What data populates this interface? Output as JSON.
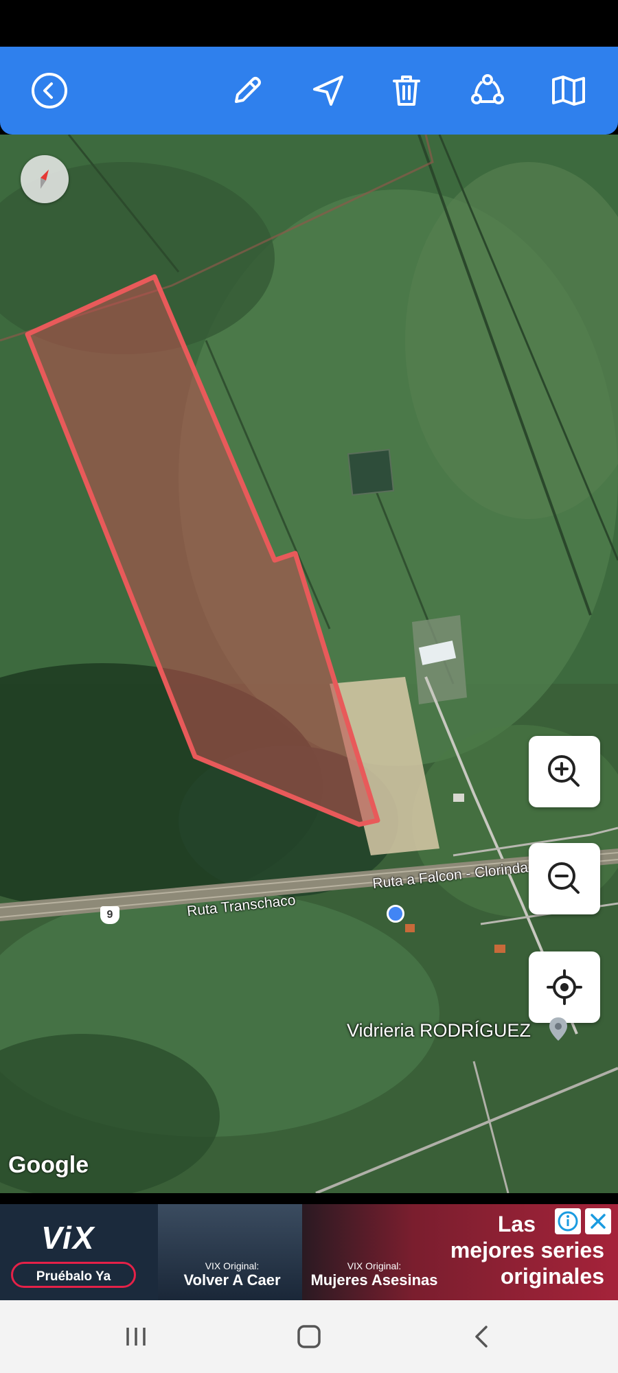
{
  "toolbar": {
    "back_icon": "back-circle-icon",
    "edit_icon": "pencil-icon",
    "navigate_icon": "navigation-arrow-icon",
    "delete_icon": "trash-icon",
    "share_icon": "share-icon",
    "map_type_icon": "map-icon",
    "color": "#2f80ed"
  },
  "map": {
    "compass_icon": "compass-icon",
    "polygon_color": "#e85a5a",
    "road_labels": [
      "Ruta Transchaco",
      "Ruta a Falcon - Clorinda"
    ],
    "route_shield": "9",
    "poi_label": "Vidrieria RODRÍGUEZ",
    "attribution": "Google",
    "zoom_in_icon": "zoom-in-icon",
    "zoom_out_icon": "zoom-out-icon",
    "my_location_icon": "my-location-icon"
  },
  "ad": {
    "brand": "ViX",
    "cta": "Pruébalo Ya",
    "shows": [
      {
        "tag": "VIX Original:",
        "title": "Volver A Caer"
      },
      {
        "tag": "VIX Original:",
        "title": "Mujeres Asesinas"
      }
    ],
    "tagline_line1": "Las",
    "tagline_line2": "mejores series",
    "tagline_line3": "originales"
  },
  "navbar": {
    "recents_icon": "recents-icon",
    "home_icon": "home-icon",
    "back_icon": "back-chevron-icon"
  }
}
